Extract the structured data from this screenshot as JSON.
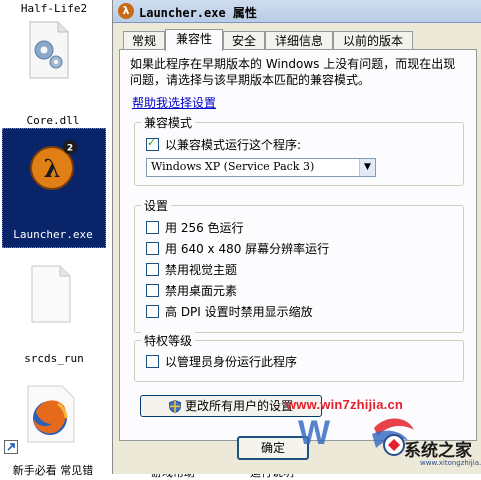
{
  "desktop": {
    "icons": [
      {
        "label": "Half-Life2"
      },
      {
        "label": "Core.dll"
      },
      {
        "label": "Launcher.exe"
      },
      {
        "label": "srcds_run"
      },
      {
        "label": "新手必看 常见错"
      },
      {
        "label": "游戏帮助"
      },
      {
        "label": "运行说明"
      }
    ]
  },
  "dialog": {
    "title": "Launcher.exe 属性",
    "tabs": [
      "常规",
      "兼容性",
      "安全",
      "详细信息",
      "以前的版本"
    ],
    "active_tab": "兼容性",
    "intro": "如果此程序在早期版本的 Windows 上没有问题，而现在出现问题，请选择与该早期版本匹配的兼容模式。",
    "help_link": "帮助我选择设置",
    "compat_group": {
      "title": "兼容模式",
      "checkbox_label": "以兼容模式运行这个程序:",
      "checked": true,
      "selected_os": "Windows XP (Service Pack 3)"
    },
    "settings_group": {
      "title": "设置",
      "options": [
        {
          "label": "用 256 色运行",
          "checked": false
        },
        {
          "label": "用 640 x 480 屏幕分辨率运行",
          "checked": false
        },
        {
          "label": "禁用视觉主题",
          "checked": false
        },
        {
          "label": "禁用桌面元素",
          "checked": false
        },
        {
          "label": "高 DPI 设置时禁用显示缩放",
          "checked": false
        }
      ]
    },
    "privilege_group": {
      "title": "特权等级",
      "checkbox_label": "以管理员身份运行此程序",
      "checked": false
    },
    "all_users_button": "更改所有用户的设置",
    "ok_button": "确定"
  },
  "watermark": {
    "url": "www.win7zhijia.cn",
    "brand": "系统之家",
    "sub": "www.xitongzhijia.net"
  },
  "colors": {
    "selection": "#0a246a",
    "link": "#0000cc",
    "watermark_red": "#e3202b",
    "dialog_bg": "#ece9d8",
    "panel_bg": "#fcfcfe"
  }
}
